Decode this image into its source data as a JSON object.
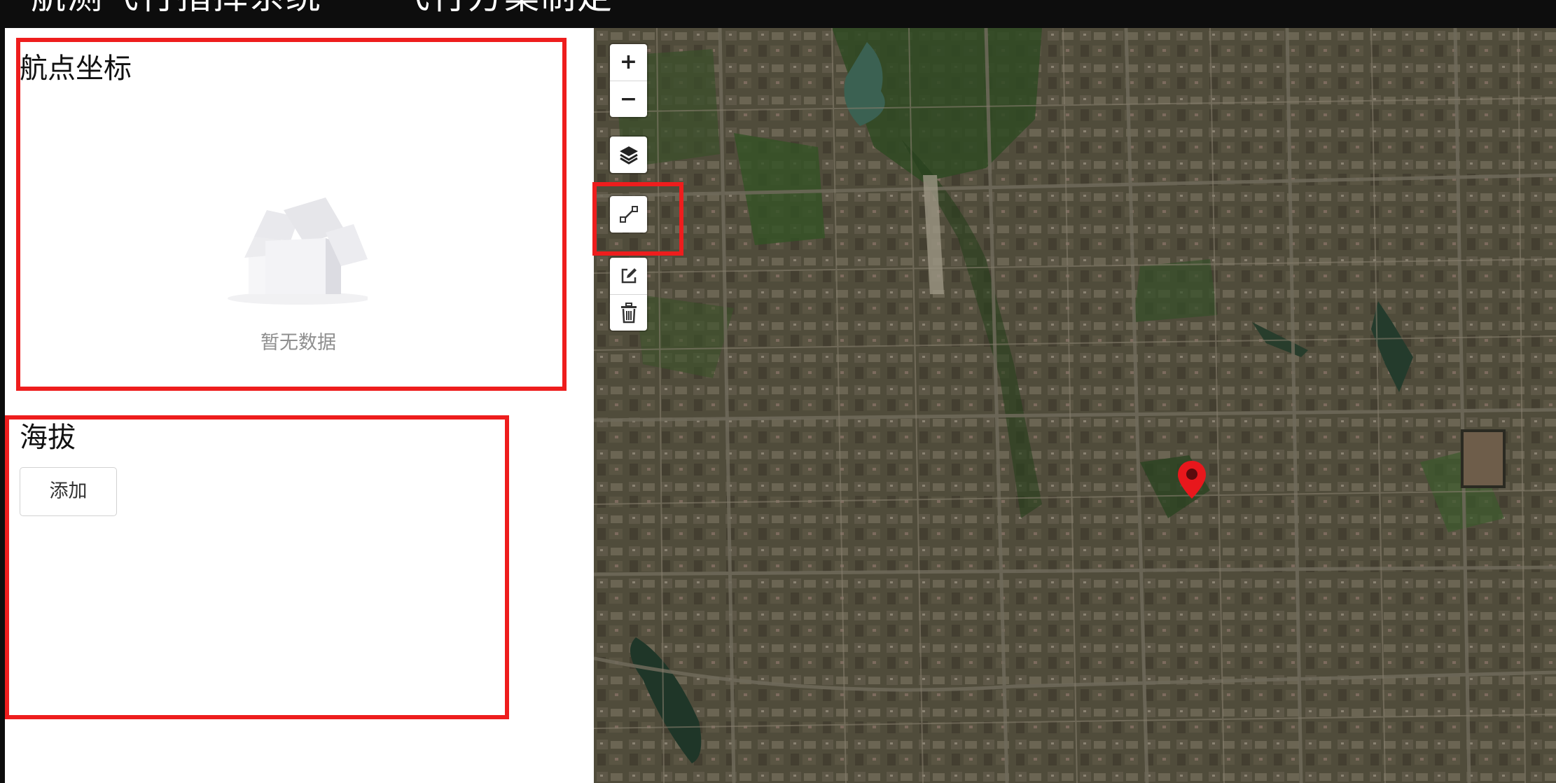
{
  "header": {
    "title": "航测飞行指挥系统——飞行方案制定"
  },
  "waypoints_section": {
    "title": "航点坐标",
    "empty_text": "暂无数据"
  },
  "altitude_section": {
    "title": "海拔",
    "add_label": "添加"
  },
  "map": {
    "zoom_in_label": "+",
    "zoom_out_label": "−",
    "controls": [
      "zoom-in-icon",
      "zoom-out-icon",
      "layers-icon",
      "draw-polyline-icon",
      "edit-layers-icon",
      "delete-layers-icon"
    ],
    "marker": "map-marker-icon"
  },
  "colors": {
    "annotation": "#ee1d1d",
    "header_bg": "#0d0d0d",
    "marker": "#e8171c"
  }
}
